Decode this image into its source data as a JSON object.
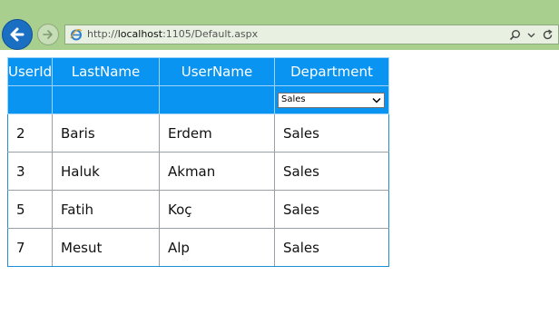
{
  "browser": {
    "url_prefix": "http://",
    "url_host": "localhost",
    "url_rest": ":1105/Default.aspx"
  },
  "icons": {
    "back": "back-arrow-icon",
    "forward": "forward-arrow-icon",
    "page": "ie-page-icon",
    "search": "search-icon",
    "dropdown": "chevron-down-icon",
    "refresh": "refresh-icon"
  },
  "colors": {
    "header_bg": "#0a94f2",
    "chrome_bg": "#a9cf8e"
  },
  "grid": {
    "columns": [
      "UserId",
      "LastName",
      "UserName",
      "Department"
    ],
    "filter": {
      "department_selected": "Sales"
    },
    "rows": [
      [
        "2",
        "Baris",
        "Erdem",
        "Sales"
      ],
      [
        "3",
        "Haluk",
        "Akman",
        "Sales"
      ],
      [
        "5",
        "Fatih",
        "Koç",
        "Sales"
      ],
      [
        "7",
        "Mesut",
        "Alp",
        "Sales"
      ]
    ]
  }
}
